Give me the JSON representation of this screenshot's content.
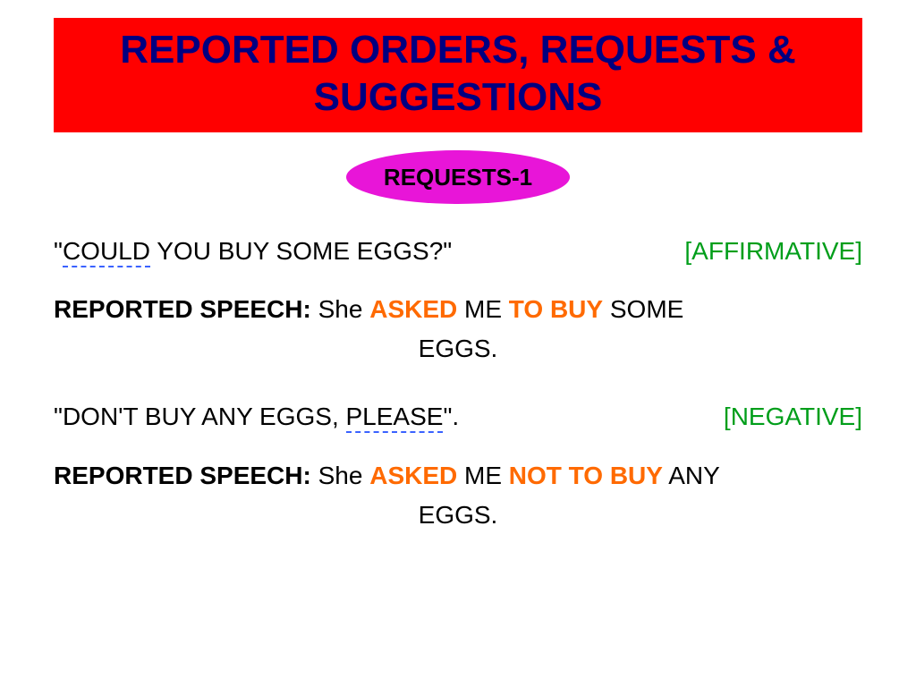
{
  "title": {
    "line1": "REPORTED ORDERS, REQUESTS &",
    "line2": "SUGGESTIONS"
  },
  "subtitle": "REQUESTS-1",
  "example1": {
    "quote_open": "\"",
    "dashed_word": "COULD",
    "quote_rest": " YOU BUY SOME EGGS?\"",
    "tag": "[AFFIRMATIVE]"
  },
  "reported1": {
    "label": "REPORTED SPEECH:",
    "pre": " She ",
    "asked": "ASKED",
    "mid": " ME ",
    "tobuy": "TO BUY",
    "post1": " SOME",
    "post2": "EGGS."
  },
  "example2": {
    "quote_pre": "\"DON'T BUY ANY EGGS, ",
    "dashed_word": "PLEASE",
    "quote_post": "\".",
    "tag": "[NEGATIVE]"
  },
  "reported2": {
    "label": "REPORTED SPEECH:",
    "pre": " She ",
    "asked": "ASKED",
    "mid": " ME ",
    "nottobuy": "NOT TO BUY",
    "post1": " ANY",
    "post2": "EGGS."
  }
}
